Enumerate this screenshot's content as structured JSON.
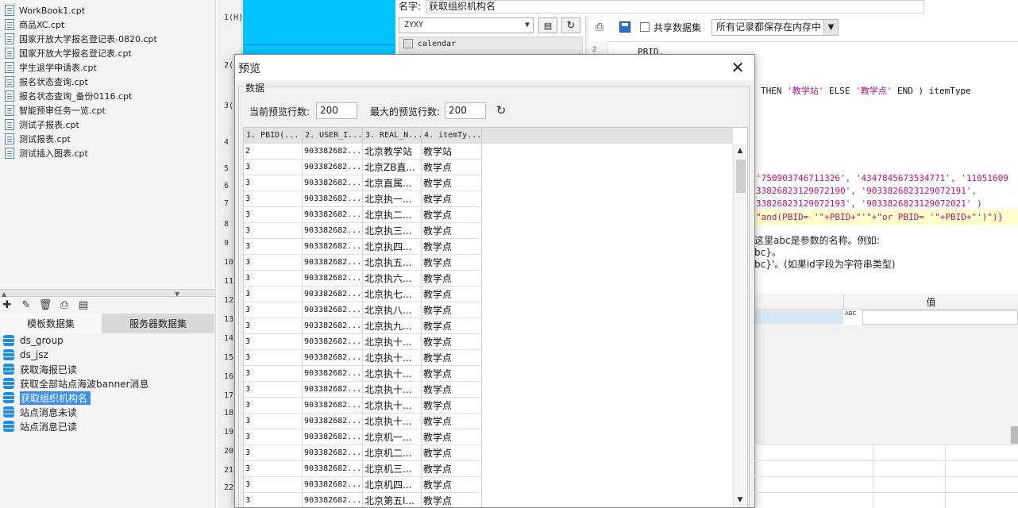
{
  "files": [
    "WorkBook1.cpt",
    "商品XC.cpt",
    "国家开放大学报名登记表-0820.cpt",
    "国家开放大学报名登记表.cpt",
    "学生退学申请表.cpt",
    "报名状态查询.cpt",
    "报名状态查询_备份0116.cpt",
    "智能预审任务一览.cpt",
    "测试子报表.cpt",
    "测试报表.cpt",
    "测试插入图表.cpt"
  ],
  "dataset_tabs": {
    "template": "模板数据集",
    "server": "服务器数据集"
  },
  "datasets": [
    "ds_group",
    "ds_jsz",
    "获取海报已读",
    "获取全部站点海波banner消息",
    "获取组织机构名",
    "站点消息未读",
    "站点消息已读"
  ],
  "selected_dataset_index": 4,
  "row_headers": [
    "1(H)",
    "2(",
    "3(",
    "4",
    "5",
    "6",
    "7",
    "8",
    "9",
    "10",
    "11",
    "12",
    "13",
    "14",
    "15",
    "16",
    "17",
    "18",
    "19",
    "20",
    "21",
    "22"
  ],
  "editor": {
    "name_label": "名字:",
    "name_value": "获取组织机构名",
    "schema": "ZYXY",
    "table": "calendar",
    "shared_label": "共享数据集",
    "memory_option": "所有记录都保存在内存中",
    "sql_line_number": "2",
    "sql": {
      "line1": "PBID,",
      "line2_kw": "THEN",
      "line2_s1": "'教学站'",
      "line2_else": "ELSE",
      "line2_s2": "'教学点'",
      "line2_end": "END ) itemType",
      "line3_s1": "'750903746711326',",
      "line3_s2": "'4347845673534771',",
      "line3_s3": "'11051609",
      "line4_s1": "33826823129072190',",
      "line4_s2": "'9033826823129072191',",
      "line5_s1": "33826823129072193',",
      "line5_s2": "'9033826823129072021' )",
      "line6": "\"and(PBID= '\"+PBID+\"'\"+\"or PBID= '\"+PBID+\"')\")}"
    },
    "hint1": "这里abc是参数的名称。例如:",
    "hint2": "bc}。",
    "hint3": "bc}'。(如果id字段为字符串类型)",
    "param_value_header": "值",
    "param_type": "ABC"
  },
  "dialog": {
    "title": "预览",
    "group_label": "数据",
    "current_rows_label": "当前预览行数:",
    "current_rows_value": "200",
    "max_rows_label": "最大的预览行数:",
    "max_rows_value": "200",
    "columns": [
      "1. PBID(...",
      "2. USER_I...",
      "3. REAL_N...",
      "4. itemTy..."
    ],
    "rows": [
      [
        "2",
        "903382682...",
        "北京教学站",
        "教学站"
      ],
      [
        "3",
        "903382682...",
        "北京ZB直...",
        "教学点"
      ],
      [
        "3",
        "903382682...",
        "北京直属...",
        "教学点"
      ],
      [
        "3",
        "903382682...",
        "北京执一...",
        "教学点"
      ],
      [
        "3",
        "903382682...",
        "北京执二...",
        "教学点"
      ],
      [
        "3",
        "903382682...",
        "北京执三...",
        "教学点"
      ],
      [
        "3",
        "903382682...",
        "北京执四...",
        "教学点"
      ],
      [
        "3",
        "903382682...",
        "北京执五...",
        "教学点"
      ],
      [
        "3",
        "903382682...",
        "北京执六...",
        "教学点"
      ],
      [
        "3",
        "903382682...",
        "北京执七...",
        "教学点"
      ],
      [
        "3",
        "903382682...",
        "北京执八...",
        "教学点"
      ],
      [
        "3",
        "903382682...",
        "北京执九...",
        "教学点"
      ],
      [
        "3",
        "903382682...",
        "北京执十...",
        "教学点"
      ],
      [
        "3",
        "903382682...",
        "北京执十...",
        "教学点"
      ],
      [
        "3",
        "903382682...",
        "北京执十...",
        "教学点"
      ],
      [
        "3",
        "903382682...",
        "北京执十...",
        "教学点"
      ],
      [
        "3",
        "903382682...",
        "北京执十...",
        "教学点"
      ],
      [
        "3",
        "903382682...",
        "北京执十...",
        "教学点"
      ],
      [
        "3",
        "903382682...",
        "北京机一...",
        "教学点"
      ],
      [
        "3",
        "903382682...",
        "北京机二...",
        "教学点"
      ],
      [
        "3",
        "903382682...",
        "北京机三...",
        "教学点"
      ],
      [
        "3",
        "903382682...",
        "北京机四...",
        "教学点"
      ],
      [
        "3",
        "903382682...",
        "北京第五I...",
        "教学点"
      ]
    ]
  },
  "colors": {
    "accent": "#00c3ff",
    "selection": "#3f8fe8",
    "db_icon": "#1f8de0",
    "sql_string": "#b4117a"
  },
  "icons": {
    "toolbar": [
      "add-icon",
      "edit-icon",
      "delete-icon",
      "preview-icon",
      "sql-preview-icon"
    ],
    "dialog_close": "close-icon",
    "dialog_refresh": "refresh-icon"
  }
}
